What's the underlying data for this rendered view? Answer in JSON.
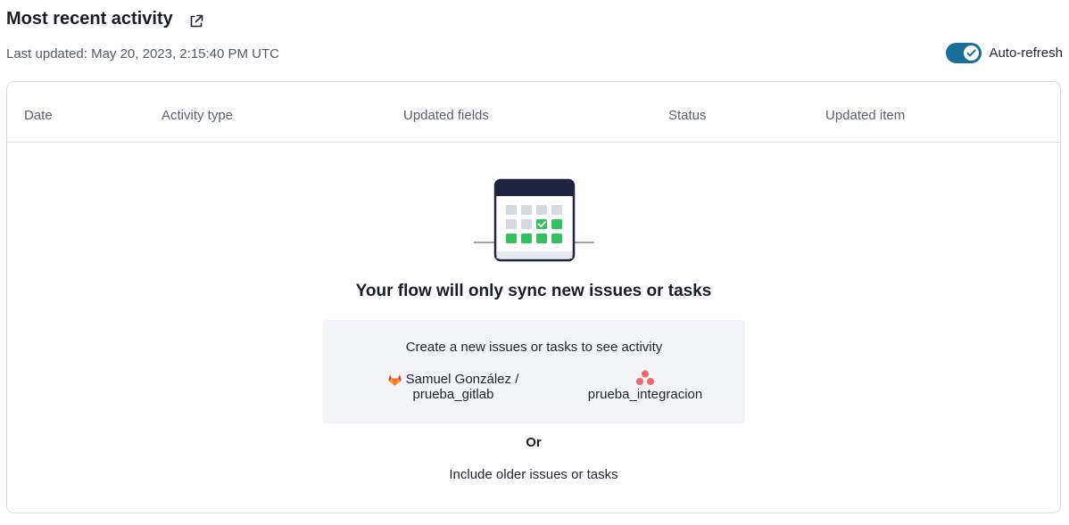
{
  "header": {
    "title": "Most recent activity",
    "last_updated": "Last updated: May 20, 2023, 2:15:40 PM UTC",
    "auto_refresh_label": "Auto-refresh",
    "auto_refresh_on": true,
    "accent_color": "#1c6e99"
  },
  "table": {
    "columns": [
      "Date",
      "Activity type",
      "Updated fields",
      "Status",
      "Updated item"
    ],
    "rows": []
  },
  "empty_state": {
    "title": "Your flow will only sync new issues or tasks",
    "cta_text": "Create a new issues or tasks to see activity",
    "gitlab_repo_line1": "Samuel González /",
    "gitlab_repo_line2": "prueba_gitlab",
    "asana_project": "prueba_integracion",
    "or_text": "Or",
    "include_older": "Include older issues or tasks"
  },
  "icons": [
    "external-link-icon",
    "check-icon",
    "calendar-icon",
    "gitlab-icon",
    "asana-icon"
  ]
}
